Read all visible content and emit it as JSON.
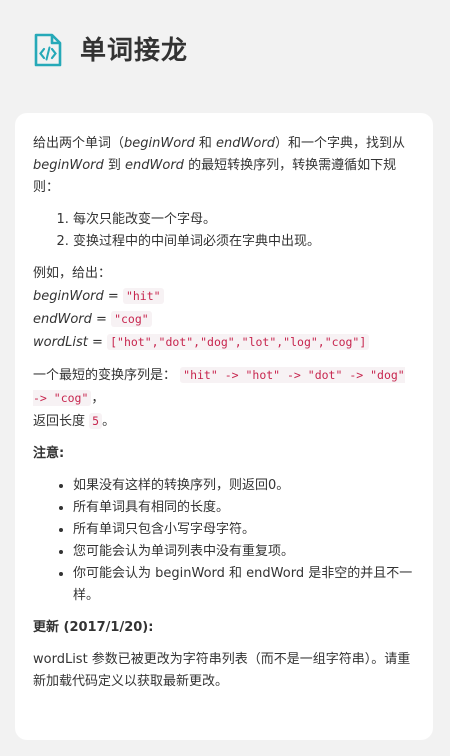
{
  "header": {
    "title": "单词接龙",
    "icon": "code-file-icon",
    "icon_color": "#26a9b8"
  },
  "intro": {
    "p1_a": "给出两个单词（",
    "p1_begin": "beginWord",
    "p1_b": " 和 ",
    "p1_end": "endWord",
    "p1_c": "）和一个字典，找到从 ",
    "p1_begin2": "beginWord",
    "p1_d": " 到 ",
    "p1_end2": "endWord",
    "p1_e": " 的最短转换序列，转换需遵循如下规则："
  },
  "rules": [
    "每次只能改变一个字母。",
    "变换过程中的中间单词必须在字典中出现。"
  ],
  "example": {
    "lead": "例如，给出：",
    "begin_label": "beginWord",
    "begin_eq": " = ",
    "begin_value": "\"hit\"",
    "end_label": "endWord",
    "end_eq": " = ",
    "end_value": "\"cog\"",
    "list_label": "wordList",
    "list_eq": " = ",
    "list_value": "[\"hot\",\"dot\",\"dog\",\"lot\",\"log\",\"cog\"]"
  },
  "result": {
    "lead": "一个最短的变换序列是：",
    "sequence": "\"hit\" -> \"hot\" -> \"dot\" -> \"dog\" -> \"cog\"",
    "comma": "，",
    "return_text": "返回长度 ",
    "return_value": "5",
    "period": "。"
  },
  "notes": {
    "heading": "注意:",
    "items": [
      "如果没有这样的转换序列，则返回0。",
      "所有单词具有相同的长度。",
      "所有单词只包含小写字母字符。",
      "您可能会认为单词列表中没有重复项。",
      "你可能会认为 beginWord 和 endWord 是非空的并且不一样。"
    ]
  },
  "update": {
    "heading": "更新 (2017/1/20):",
    "text": "wordList 参数已被更改为字符串列表（而不是一组字符串）。请重新加载代码定义以获取最新更改。"
  }
}
